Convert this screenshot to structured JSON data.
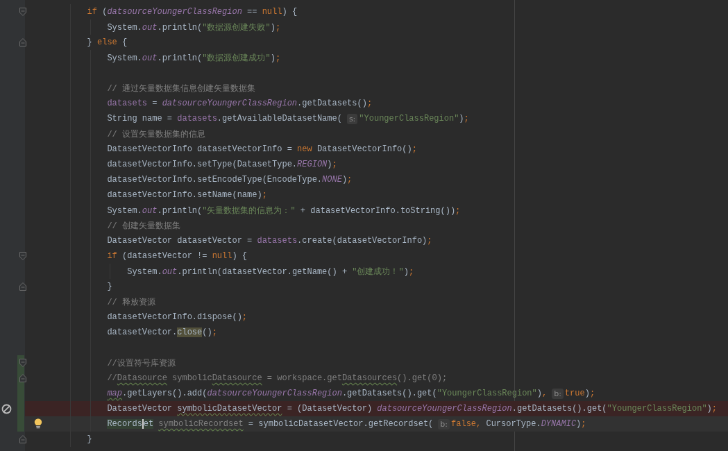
{
  "editor": {
    "lines": [
      {
        "changed": false,
        "fold_start": true,
        "tokens": [
          {
            "text": "if",
            "kind": "keyword"
          },
          {
            "text": " (",
            "kind": "plain"
          },
          {
            "text": "datsourceYoungerClassRegion",
            "kind": "field"
          },
          {
            "text": " == ",
            "kind": "plain"
          },
          {
            "text": "null",
            "kind": "keyword"
          },
          {
            "text": ") {",
            "kind": "plain"
          }
        ],
        "children": [
          {
            "changed": false,
            "tokens": [
              {
                "text": "System.",
                "kind": "plain"
              },
              {
                "text": "out",
                "kind": "field"
              },
              {
                "text": ".println(",
                "kind": "plain"
              },
              {
                "text": "\"数据源创建失败\"",
                "kind": "string"
              },
              {
                "text": ")",
                "kind": "plain"
              },
              {
                "text": ";",
                "kind": "punct"
              }
            ]
          }
        ]
      },
      {
        "changed": false,
        "fold_end": true,
        "tokens": [
          {
            "text": "} ",
            "kind": "plain"
          },
          {
            "text": "else",
            "kind": "keyword"
          },
          {
            "text": " {",
            "kind": "plain"
          }
        ],
        "children": [
          {
            "changed": false,
            "tokens": [
              {
                "text": "System.",
                "kind": "plain"
              },
              {
                "text": "out",
                "kind": "field"
              },
              {
                "text": ".println(",
                "kind": "plain"
              },
              {
                "text": "\"数据源创建成功\"",
                "kind": "string"
              },
              {
                "text": ")",
                "kind": "plain"
              },
              {
                "text": ";",
                "kind": "punct"
              }
            ]
          },
          {
            "changed": false
          },
          {
            "changed": false,
            "tokens": [
              {
                "text": "// 通过矢量数据集信息创建矢量数据集",
                "kind": "comment"
              }
            ]
          },
          {
            "changed": false,
            "tokens": [
              {
                "text": "datasets",
                "kind": "member"
              },
              {
                "text": " = ",
                "kind": "plain"
              },
              {
                "text": "datsourceYoungerClassRegion",
                "kind": "field"
              },
              {
                "text": ".getDatasets()",
                "kind": "plain"
              },
              {
                "text": ";",
                "kind": "punct"
              }
            ]
          },
          {
            "changed": false,
            "tokens": [
              {
                "text": "String name = ",
                "kind": "plain"
              },
              {
                "text": "datasets",
                "kind": "member"
              },
              {
                "text": ".getAvailableDatasetName(",
                "kind": "plain"
              },
              {
                "text": "s:",
                "kind": "hint"
              },
              {
                "text": "\"YoungerClassRegion\"",
                "kind": "string"
              },
              {
                "text": ")",
                "kind": "plain"
              },
              {
                "text": ";",
                "kind": "punct"
              }
            ]
          },
          {
            "changed": false,
            "tokens": [
              {
                "text": "// 设置矢量数据集的信息",
                "kind": "comment"
              }
            ]
          },
          {
            "changed": false,
            "tokens": [
              {
                "text": "DatasetVectorInfo datasetVectorInfo = ",
                "kind": "plain"
              },
              {
                "text": "new",
                "kind": "keyword"
              },
              {
                "text": " DatasetVectorInfo()",
                "kind": "plain"
              },
              {
                "text": ";",
                "kind": "punct"
              }
            ]
          },
          {
            "changed": false,
            "tokens": [
              {
                "text": "datasetVectorInfo.setType(DatasetType.",
                "kind": "plain"
              },
              {
                "text": "REGION",
                "kind": "field"
              },
              {
                "text": ")",
                "kind": "plain"
              },
              {
                "text": ";",
                "kind": "punct"
              }
            ]
          },
          {
            "changed": false,
            "tokens": [
              {
                "text": "datasetVectorInfo.setEncodeType(EncodeType.",
                "kind": "plain"
              },
              {
                "text": "NONE",
                "kind": "field"
              },
              {
                "text": ")",
                "kind": "plain"
              },
              {
                "text": ";",
                "kind": "punct"
              }
            ]
          },
          {
            "changed": false,
            "tokens": [
              {
                "text": "datasetVectorInfo.setName(name)",
                "kind": "plain"
              },
              {
                "text": ";",
                "kind": "punct"
              }
            ]
          },
          {
            "changed": false,
            "tokens": [
              {
                "text": "System.",
                "kind": "plain"
              },
              {
                "text": "out",
                "kind": "field"
              },
              {
                "text": ".println(",
                "kind": "plain"
              },
              {
                "text": "\"矢量数据集的信息为：\"",
                "kind": "string"
              },
              {
                "text": " + datasetVectorInfo.toString())",
                "kind": "plain"
              },
              {
                "text": ";",
                "kind": "punct"
              }
            ]
          },
          {
            "changed": false,
            "tokens": [
              {
                "text": "// 创建矢量数据集",
                "kind": "comment"
              }
            ]
          },
          {
            "changed": false,
            "tokens": [
              {
                "text": "DatasetVector datasetVector = ",
                "kind": "plain"
              },
              {
                "text": "datasets",
                "kind": "member"
              },
              {
                "text": ".create(datasetVectorInfo)",
                "kind": "plain"
              },
              {
                "text": ";",
                "kind": "punct"
              }
            ]
          },
          {
            "changed": false,
            "fold_start": true,
            "tokens": [
              {
                "text": "if",
                "kind": "keyword"
              },
              {
                "text": " (datasetVector != ",
                "kind": "plain"
              },
              {
                "text": "null",
                "kind": "keyword"
              },
              {
                "text": ") {",
                "kind": "plain"
              }
            ],
            "children": [
              {
                "changed": false,
                "tokens": [
                  {
                    "text": "System.",
                    "kind": "plain"
                  },
                  {
                    "text": "out",
                    "kind": "field"
                  },
                  {
                    "text": ".println(datasetVector.getName() + ",
                    "kind": "plain"
                  },
                  {
                    "text": "\"创建成功！\"",
                    "kind": "string"
                  },
                  {
                    "text": ")",
                    "kind": "plain"
                  },
                  {
                    "text": ";",
                    "kind": "punct"
                  }
                ]
              }
            ]
          },
          {
            "changed": false,
            "fold_end": true,
            "tokens": [
              {
                "text": "}",
                "kind": "plain"
              }
            ]
          },
          {
            "changed": false,
            "tokens": [
              {
                "text": "// 释放资源",
                "kind": "comment"
              }
            ]
          },
          {
            "changed": false,
            "tokens": [
              {
                "text": "datasetVectorInfo.dispose()",
                "kind": "plain"
              },
              {
                "text": ";",
                "kind": "punct"
              }
            ]
          },
          {
            "changed": false,
            "tokens": [
              {
                "text": "datasetVector.",
                "kind": "plain"
              },
              {
                "text": "close",
                "kind": "match"
              },
              {
                "text": "()",
                "kind": "plain"
              },
              {
                "text": ";",
                "kind": "punct"
              }
            ]
          },
          {
            "changed": false
          },
          {
            "changed": true,
            "fold_start": true,
            "tokens": [
              {
                "text": "//设置符号库资源",
                "kind": "comment"
              }
            ]
          },
          {
            "changed": true,
            "fold_end": true,
            "tokens": [
              {
                "text": "//",
                "kind": "comment"
              },
              {
                "text": "Datasource",
                "kind": "comment",
                "warning": true
              },
              {
                "text": " symbolic",
                "kind": "comment"
              },
              {
                "text": "Datasource",
                "kind": "comment",
                "warning": true
              },
              {
                "text": " = workspace.get",
                "kind": "comment"
              },
              {
                "text": "Datasources",
                "kind": "comment",
                "warning": true
              },
              {
                "text": "().get(0);",
                "kind": "comment"
              }
            ]
          },
          {
            "changed": true,
            "tokens": [
              {
                "text": "map",
                "kind": "field",
                "warning": true
              },
              {
                "text": ".getLayers().add(",
                "kind": "plain"
              },
              {
                "text": "datsourceYoungerClassRegion",
                "kind": "field"
              },
              {
                "text": ".getDatasets().get(",
                "kind": "plain"
              },
              {
                "text": "\"YoungerClassRegion\"",
                "kind": "string"
              },
              {
                "text": ")",
                "kind": "plain"
              },
              {
                "text": ",",
                "kind": "punct"
              },
              {
                "text": "b:",
                "kind": "hint"
              },
              {
                "text": "true",
                "kind": "keyword"
              },
              {
                "text": ")",
                "kind": "plain"
              },
              {
                "text": ";",
                "kind": "punct"
              }
            ]
          },
          {
            "changed": true,
            "error": true,
            "tokens": [
              {
                "text": "DatasetVector ",
                "kind": "plain"
              },
              {
                "text": "symbolicDatasetVector",
                "kind": "plain",
                "warning": true
              },
              {
                "text": " = (DatasetVector) ",
                "kind": "plain"
              },
              {
                "text": "datsourceYoungerClassRegion",
                "kind": "field"
              },
              {
                "text": ".getDatasets().get(",
                "kind": "plain"
              },
              {
                "text": "\"YoungerClassRegion\"",
                "kind": "string"
              },
              {
                "text": ")",
                "kind": "plain"
              },
              {
                "text": ";",
                "kind": "punct"
              }
            ]
          },
          {
            "changed": true,
            "current": true,
            "bulb": true,
            "tokens": [
              {
                "text": "Records",
                "kind": "usage",
                "caret": true
              },
              {
                "text": "et",
                "kind": "usage"
              },
              {
                "text": "symbolicRecordset",
                "kind": "unused",
                "warning": true
              },
              {
                "text": " = symbolicDatasetVector.getRecordset(",
                "kind": "plain"
              },
              {
                "text": "b:",
                "kind": "hint"
              },
              {
                "text": "false",
                "kind": "keyword"
              },
              {
                "text": ",",
                "kind": "punct"
              },
              {
                "text": " CursorType.",
                "kind": "plain"
              },
              {
                "text": "DYNAMIC",
                "kind": "field"
              },
              {
                "text": ")",
                "kind": "plain"
              },
              {
                "text": ";",
                "kind": "punct"
              }
            ]
          }
        ]
      },
      {
        "changed": false,
        "fold_end": true,
        "tokens": [
          {
            "text": "}",
            "kind": "plain"
          }
        ]
      }
    ]
  }
}
